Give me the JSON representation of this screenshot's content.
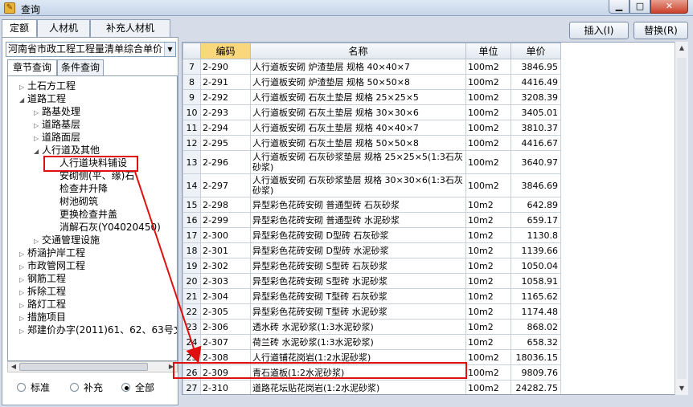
{
  "window": {
    "title": "查询"
  },
  "top_tabs": [
    "定额",
    "人材机",
    "补充人材机"
  ],
  "actions": {
    "insert": "插入(I)",
    "replace": "替换(R)"
  },
  "standard_selector": "河南省市政工程工程量清单综合单价",
  "sub_tabs": [
    "章节查询",
    "条件查询"
  ],
  "tree": [
    {
      "label": "土石方工程",
      "level": 0,
      "expanded": false
    },
    {
      "label": "道路工程",
      "level": 0,
      "expanded": true
    },
    {
      "label": "路基处理",
      "level": 1,
      "expanded": false
    },
    {
      "label": "道路基层",
      "level": 1,
      "expanded": false
    },
    {
      "label": "道路面层",
      "level": 1,
      "expanded": false
    },
    {
      "label": "人行道及其他",
      "level": 1,
      "expanded": true
    },
    {
      "label": "人行道块料铺设",
      "level": 2,
      "selected": true
    },
    {
      "label": "安砌侧(平、缘)石",
      "level": 2
    },
    {
      "label": "检查井升降",
      "level": 2
    },
    {
      "label": "树池砌筑",
      "level": 2
    },
    {
      "label": "更换检查井盖",
      "level": 2
    },
    {
      "label": "消解石灰(Y04020450)",
      "level": 2
    },
    {
      "label": "交通管理设施",
      "level": 1,
      "expanded": false
    },
    {
      "label": "桥涵护岸工程",
      "level": 0,
      "expanded": false
    },
    {
      "label": "市政管网工程",
      "level": 0,
      "expanded": false
    },
    {
      "label": "钢筋工程",
      "level": 0,
      "expanded": false
    },
    {
      "label": "拆除工程",
      "level": 0,
      "expanded": false
    },
    {
      "label": "路灯工程",
      "level": 0,
      "expanded": false
    },
    {
      "label": "措施项目",
      "level": 0,
      "expanded": false
    },
    {
      "label": "郑建价办字(2011)61、62、63号文",
      "level": 0,
      "expanded": false
    }
  ],
  "filter": {
    "options": [
      "标准",
      "补充",
      "全部"
    ],
    "selected": "全部"
  },
  "grid": {
    "columns": [
      "",
      "编码",
      "名称",
      "单位",
      "单价"
    ],
    "rows": [
      {
        "idx": "7",
        "code": "2-290",
        "name": "人行道板安砌 炉渣垫层 规格 40×40×7",
        "unit": "100m2",
        "price": "3846.95"
      },
      {
        "idx": "8",
        "code": "2-291",
        "name": "人行道板安砌 炉渣垫层 规格 50×50×8",
        "unit": "100m2",
        "price": "4416.49"
      },
      {
        "idx": "9",
        "code": "2-292",
        "name": "人行道板安砌 石灰土垫层 规格 25×25×5",
        "unit": "100m2",
        "price": "3208.39"
      },
      {
        "idx": "10",
        "code": "2-293",
        "name": "人行道板安砌 石灰土垫层 规格 30×30×6",
        "unit": "100m2",
        "price": "3405.01"
      },
      {
        "idx": "11",
        "code": "2-294",
        "name": "人行道板安砌 石灰土垫层 规格 40×40×7",
        "unit": "100m2",
        "price": "3810.37"
      },
      {
        "idx": "12",
        "code": "2-295",
        "name": "人行道板安砌 石灰土垫层 规格 50×50×8",
        "unit": "100m2",
        "price": "4416.67"
      },
      {
        "idx": "13",
        "code": "2-296",
        "name": "人行道板安砌 石灰砂浆垫层 规格 25×25×5(1:3石灰砂浆)",
        "unit": "100m2",
        "price": "3640.97",
        "tall": true
      },
      {
        "idx": "14",
        "code": "2-297",
        "name": "人行道板安砌 石灰砂浆垫层 规格 30×30×6(1:3石灰砂浆)",
        "unit": "100m2",
        "price": "3846.69",
        "tall": true
      },
      {
        "idx": "15",
        "code": "2-298",
        "name": "异型彩色花砖安砌 普通型砖 石灰砂浆",
        "unit": "10m2",
        "price": "642.89"
      },
      {
        "idx": "16",
        "code": "2-299",
        "name": "异型彩色花砖安砌 普通型砖 水泥砂浆",
        "unit": "10m2",
        "price": "659.17"
      },
      {
        "idx": "17",
        "code": "2-300",
        "name": "异型彩色花砖安砌 D型砖 石灰砂浆",
        "unit": "10m2",
        "price": "1130.8"
      },
      {
        "idx": "18",
        "code": "2-301",
        "name": "异型彩色花砖安砌 D型砖 水泥砂浆",
        "unit": "10m2",
        "price": "1139.66"
      },
      {
        "idx": "19",
        "code": "2-302",
        "name": "异型彩色花砖安砌 S型砖 石灰砂浆",
        "unit": "10m2",
        "price": "1050.04"
      },
      {
        "idx": "20",
        "code": "2-303",
        "name": "异型彩色花砖安砌 S型砖 水泥砂浆",
        "unit": "10m2",
        "price": "1058.91"
      },
      {
        "idx": "21",
        "code": "2-304",
        "name": "异型彩色花砖安砌 T型砖 石灰砂浆",
        "unit": "10m2",
        "price": "1165.62"
      },
      {
        "idx": "22",
        "code": "2-305",
        "name": "异型彩色花砖安砌 T型砖 水泥砂浆",
        "unit": "10m2",
        "price": "1174.48"
      },
      {
        "idx": "23",
        "code": "2-306",
        "name": "透水砖 水泥砂浆(1:3水泥砂浆)",
        "unit": "10m2",
        "price": "868.02"
      },
      {
        "idx": "24",
        "code": "2-307",
        "name": "荷兰砖 水泥砂浆(1:3水泥砂浆)",
        "unit": "10m2",
        "price": "658.32"
      },
      {
        "idx": "25",
        "code": "2-308",
        "name": "人行道铺花岗岩(1:2水泥砂浆)",
        "unit": "100m2",
        "price": "18036.15"
      },
      {
        "idx": "26",
        "code": "2-309",
        "name": "青石道板(1:2水泥砂浆)",
        "unit": "100m2",
        "price": "9809.76"
      },
      {
        "idx": "27",
        "code": "2-310",
        "name": "道路花坛贴花岗岩(1:2水泥砂浆)",
        "unit": "100m2",
        "price": "24282.75"
      }
    ]
  }
}
